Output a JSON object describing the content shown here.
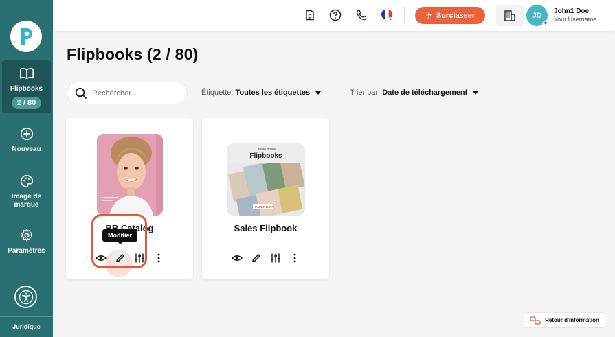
{
  "sidebar": {
    "nav": {
      "flipbooks": "Flipbooks",
      "counter": "2 / 80",
      "new": "Nouveau",
      "brand": "Image de marque",
      "settings": "Paramètres"
    },
    "legal": "Juridique"
  },
  "header": {
    "upgrade_label": "Surclasser",
    "user": {
      "initials": "JD",
      "name": "John1 Doe",
      "username": "Your Username"
    },
    "accent_color": "#e8623c"
  },
  "page": {
    "title": "Flipbooks (2 / 80)",
    "search_placeholder": "Rechercher",
    "filter_tag": {
      "label": "Étiquette:",
      "value": "Toutes les étiquettes"
    },
    "sort": {
      "label": "Trier par:",
      "value": "Date de téléchargement"
    }
  },
  "cards": [
    {
      "name": "BB Catalog",
      "tooltip": "Modifier"
    },
    {
      "name": "Sales Flipbook",
      "cover_heading_1": "Create online",
      "cover_heading_2": "Flipbooks",
      "cover_brand": "PAPERTURN"
    }
  ],
  "feedback_label": "Retour d'information",
  "icons": [
    "book-open-icon",
    "plus-circle-icon",
    "palette-icon",
    "gear-icon",
    "accessibility-icon",
    "document-icon",
    "help-icon",
    "phone-icon",
    "flag-icon",
    "arrow-up-icon",
    "building-icon",
    "search-icon",
    "eye-icon",
    "pencil-icon",
    "sliders-icon",
    "more-icon",
    "feedback-icon"
  ]
}
